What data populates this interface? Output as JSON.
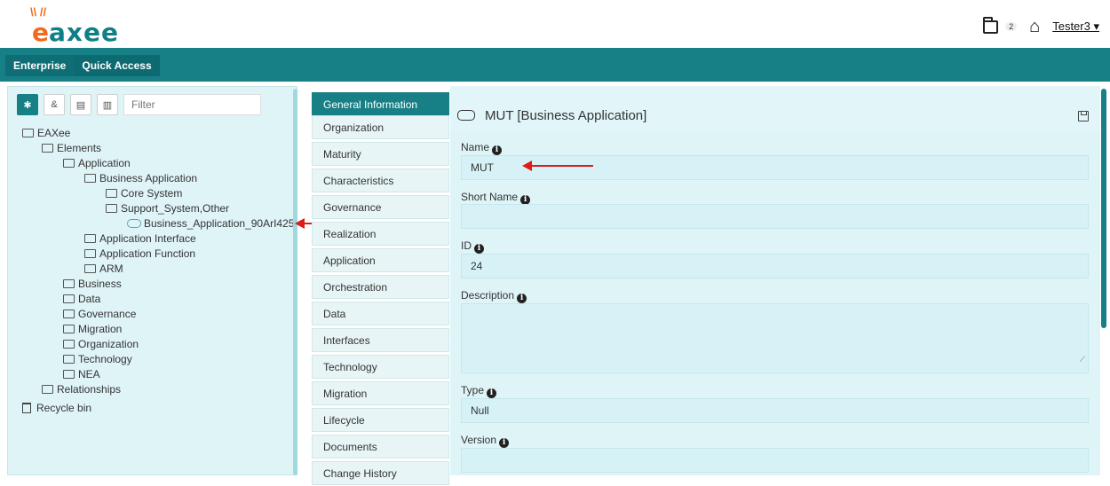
{
  "header": {
    "logo_text": "eaxee",
    "notification_count": "2",
    "user": "Tester3 ▾"
  },
  "nav": {
    "tabs": [
      "Enterprise",
      "Quick Access"
    ]
  },
  "tree": {
    "filter_placeholder": "Filter",
    "nodes": [
      {
        "label": "EAXee",
        "icon": "folder-icon"
      },
      {
        "label": "Elements",
        "icon": "folder-icon"
      },
      {
        "label": "Application",
        "icon": "folder-icon"
      },
      {
        "label": "Business Application",
        "icon": "folder-icon"
      },
      {
        "label": "Core System",
        "icon": "folder-icon"
      },
      {
        "label": "Support_System,Other",
        "icon": "folder-icon"
      },
      {
        "label": "Business_Application_90ArI425",
        "icon": "application-icon"
      },
      {
        "label": "Application Interface",
        "icon": "folder-icon"
      },
      {
        "label": "Application Function",
        "icon": "folder-icon"
      },
      {
        "label": "ARM",
        "icon": "folder-icon"
      },
      {
        "label": "Business",
        "icon": "folder-icon"
      },
      {
        "label": "Data",
        "icon": "folder-icon"
      },
      {
        "label": "Governance",
        "icon": "folder-icon"
      },
      {
        "label": "Migration",
        "icon": "folder-icon"
      },
      {
        "label": "Organization",
        "icon": "folder-icon"
      },
      {
        "label": "Technology",
        "icon": "folder-icon"
      },
      {
        "label": "NEA",
        "icon": "folder-icon"
      },
      {
        "label": "Relationships",
        "icon": "folder-icon"
      },
      {
        "label": "Recycle bin",
        "icon": "trash-icon"
      }
    ]
  },
  "tabs": [
    "General Information",
    "Organization",
    "Maturity",
    "Characteristics",
    "Governance",
    "Realization",
    "Application",
    "Orchestration",
    "Data",
    "Interfaces",
    "Technology",
    "Migration",
    "Lifecycle",
    "Documents",
    "Change History"
  ],
  "form": {
    "title": "MUT [Business Application]",
    "fields": [
      {
        "label": "Name",
        "value": "MUT"
      },
      {
        "label": "Short Name",
        "value": ""
      },
      {
        "label": "ID",
        "value": "24"
      },
      {
        "label": "Description",
        "value": ""
      },
      {
        "label": "Type",
        "value": "Null"
      },
      {
        "label": "Version",
        "value": ""
      }
    ]
  }
}
